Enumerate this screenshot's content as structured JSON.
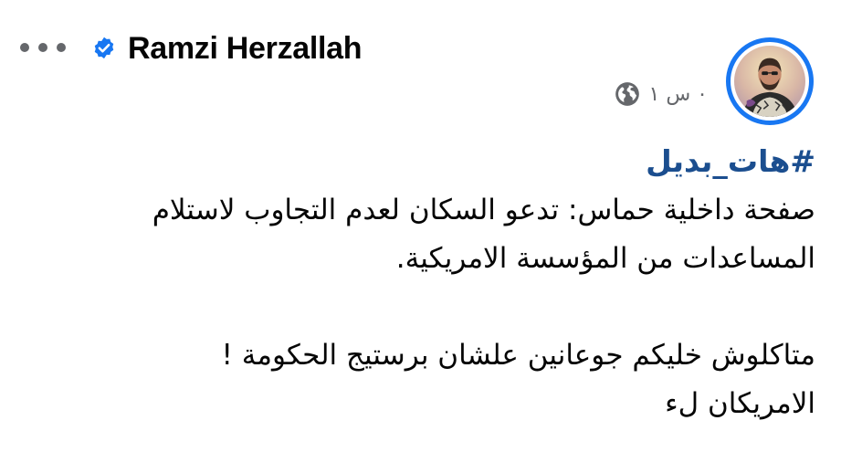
{
  "post": {
    "author": "Ramzi Herzallah",
    "timestamp": "٠ س ١",
    "hashtag": "#هات_بديل",
    "lines": [
      "صفحة داخلية حماس: تدعو السكان لعدم التجاوب لاستلام",
      "المساعدات من المؤسسة الامريكية.",
      "متاكلوش خليكم جوعانين علشان برستيج الحكومة !",
      "الامريكان لء"
    ]
  },
  "icons": {
    "more": "more-horizontal-icon",
    "verified": "verified-badge-icon",
    "privacy": "globe-icon"
  },
  "colors": {
    "accent": "#1877f2",
    "hashtag": "#1b4e8f",
    "text": "#050505",
    "muted": "#65676b"
  }
}
